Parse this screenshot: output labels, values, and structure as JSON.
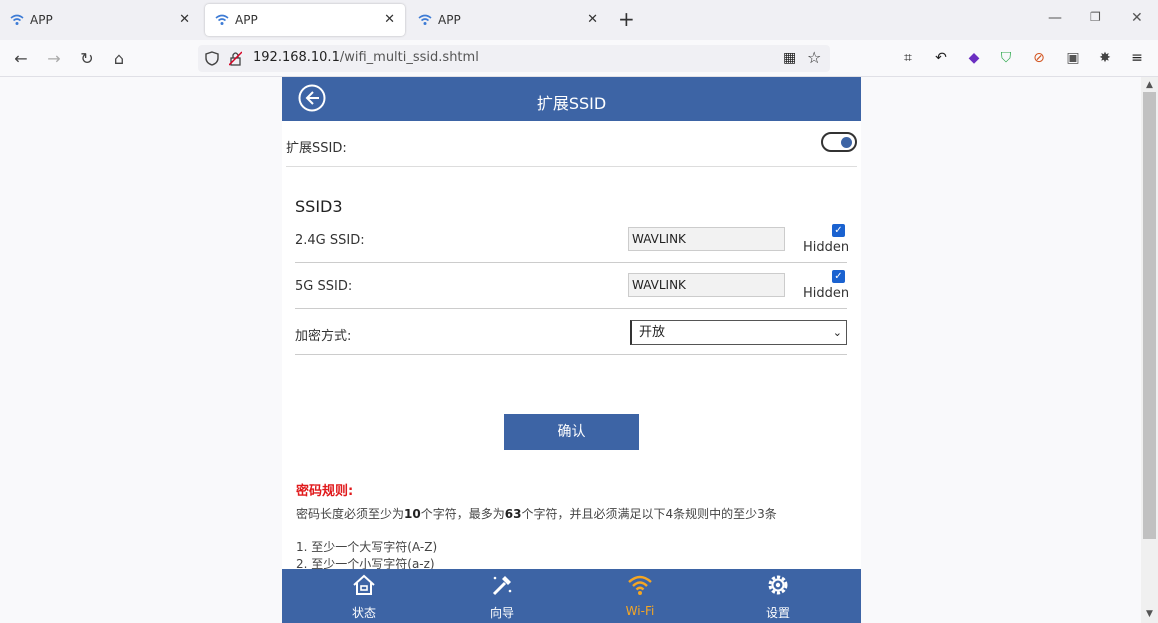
{
  "browser": {
    "tabs": [
      {
        "title": "APP",
        "active": false
      },
      {
        "title": "APP",
        "active": true
      },
      {
        "title": "APP",
        "active": false
      }
    ],
    "url_host": "192.168.10.1",
    "url_path": "/wifi_multi_ssid.shtml"
  },
  "page": {
    "title": "扩展SSID",
    "toggle_label": "扩展SSID:",
    "toggle_on": true,
    "section_title": "SSID3",
    "ssid24": {
      "label": "2.4G SSID:",
      "value": "WAVLINK",
      "hidden_label": "Hidden",
      "hidden_checked": true
    },
    "ssid5": {
      "label": "5G SSID:",
      "value": "WAVLINK",
      "hidden_label": "Hidden",
      "hidden_checked": true
    },
    "encryption": {
      "label": "加密方式:",
      "selected": "开放"
    },
    "confirm_label": "确认",
    "rules": {
      "title": "密码规则:",
      "desc_prefix": "密码长度必须至少为",
      "min_len": "10",
      "desc_mid": "个字符，最多为",
      "max_len": "63",
      "desc_suffix": "个字符，并且必须满足以下4条规则中的至少3条",
      "items": [
        "1. 至少一个大写字符(A-Z)",
        "2. 至少一个小写字符(a-z)"
      ]
    }
  },
  "bottom_nav": [
    {
      "label": "状态",
      "icon": "home-icon"
    },
    {
      "label": "向导",
      "icon": "wand-icon"
    },
    {
      "label": "Wi-Fi",
      "icon": "wifi-icon",
      "active": true
    },
    {
      "label": "设置",
      "icon": "gear-icon"
    }
  ],
  "colors": {
    "primary": "#3d64a5",
    "active_nav": "#f5a623",
    "rules_title": "#e0191b"
  }
}
